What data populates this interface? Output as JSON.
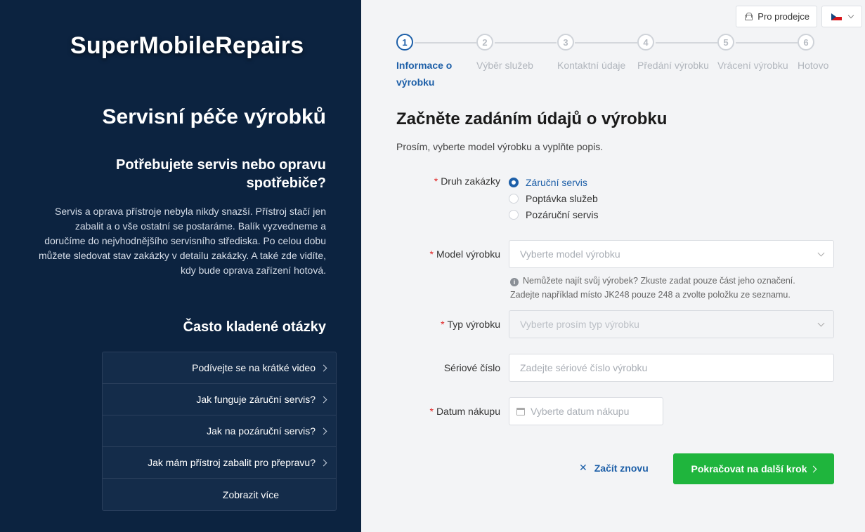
{
  "left": {
    "brand": "SuperMobileRepairs",
    "hero_title": "Servisní péče výrobků",
    "sub_title": "Potřebujete servis nebo opravu spotřebiče?",
    "description": "Servis a oprava přístroje nebyla nikdy snazší. Přístroj stačí jen zabalit a o vše ostatní se postaráme. Balík vyzvedneme a doručíme do nejvhodnějšího servisního střediska. Po celou dobu můžete sledovat stav zakázky v detailu zakázky. A také zde vidíte, kdy bude oprava zařízení hotová.",
    "faq_title": "Často kladené otázky",
    "faq_items": [
      "Podívejte se na krátké video",
      "Jak funguje záruční servis?",
      "Jak na pozáruční servis?",
      "Jak mám přístroj zabalit pro přepravu?",
      "Zobrazit více"
    ]
  },
  "topbar": {
    "seller_label": "Pro prodejce",
    "lang_icon": "czech-flag-icon"
  },
  "steps": [
    {
      "num": "1",
      "label": "Informace o výrobku",
      "active": true
    },
    {
      "num": "2",
      "label": "Výběr služeb",
      "active": false
    },
    {
      "num": "3",
      "label": "Kontaktní údaje",
      "active": false
    },
    {
      "num": "4",
      "label": "Předání výrobku",
      "active": false
    },
    {
      "num": "5",
      "label": "Vrácení výrobku",
      "active": false
    },
    {
      "num": "6",
      "label": "Hotovo",
      "active": false
    }
  ],
  "form": {
    "title": "Začněte zadáním údajů o výrobku",
    "subtitle": "Prosím, vyberte model výrobku a vyplňte popis.",
    "order_type_label": "Druh zakázky",
    "order_types": [
      "Záruční servis",
      "Poptávka služeb",
      "Pozáruční servis"
    ],
    "model_label": "Model výrobku",
    "model_placeholder": "Vyberte model výrobku",
    "model_hint_1": "Nemůžete najít svůj výrobek? Zkuste zadat pouze část jeho označení.",
    "model_hint_2": "Zadejte například místo JK248 pouze 248 a zvolte položku ze seznamu.",
    "type_label": "Typ výrobku",
    "type_placeholder": "Vyberte prosím typ výrobku",
    "serial_label": "Sériové číslo",
    "serial_placeholder": "Zadejte sériové číslo výrobku",
    "date_label": "Datum nákupu",
    "date_placeholder": "Vyberte datum nákupu",
    "reset_label": "Začít znovu",
    "continue_label": "Pokračovat na další krok"
  },
  "colors": {
    "sidebar_bg": "#0c2340",
    "accent": "#1d5fa8",
    "primary_button": "#1fb53d",
    "required": "#e02424"
  }
}
